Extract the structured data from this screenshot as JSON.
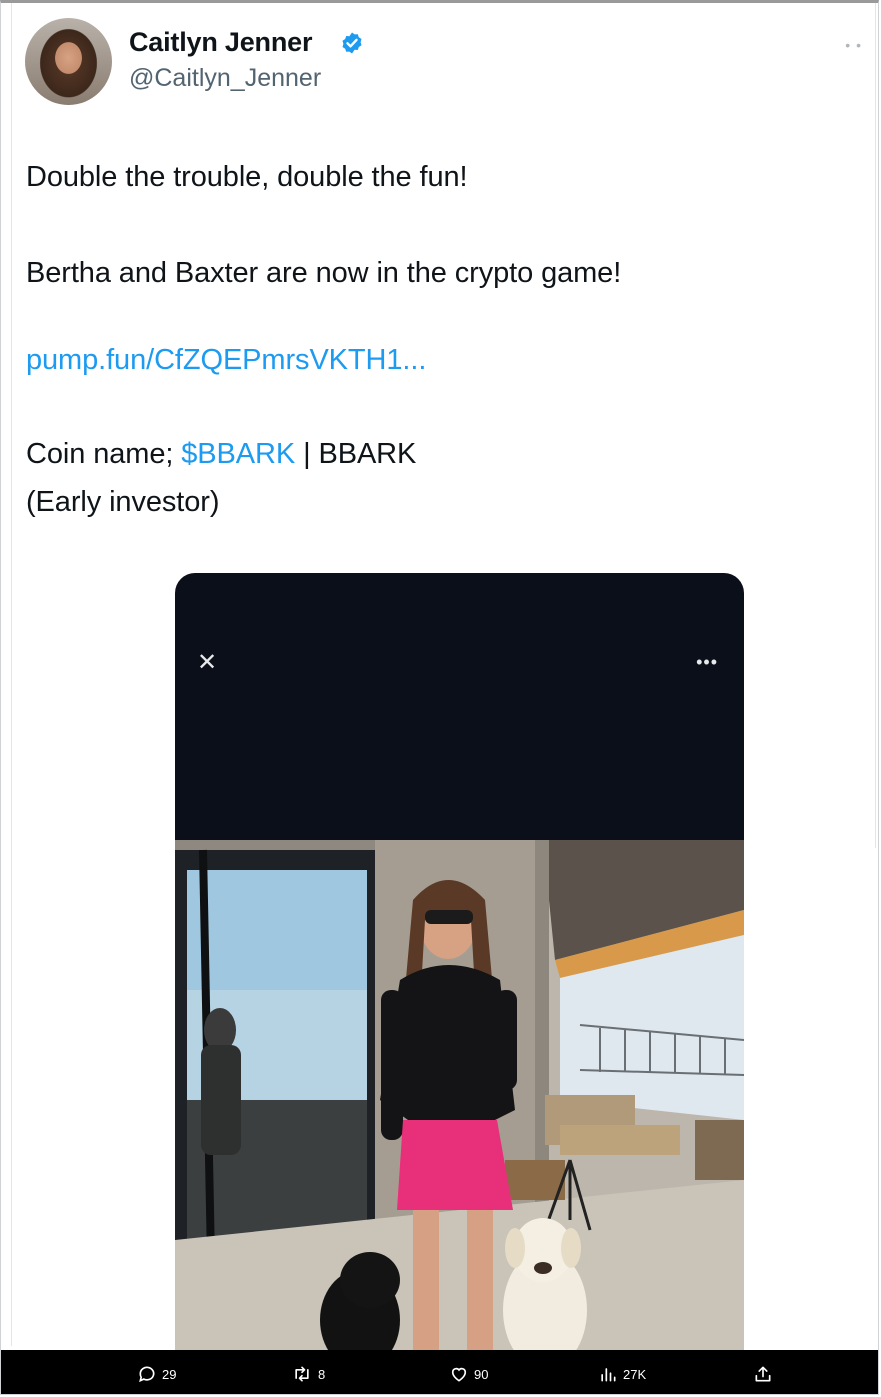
{
  "author": {
    "name": "Caitlyn Jenner",
    "handle": "@Caitlyn_Jenner",
    "verified": true
  },
  "tweet": {
    "line1": "Double the trouble, double the fun!",
    "line2": "Bertha and Baxter are now in the crypto game!",
    "link": "pump.fun/CfZQEPmrsVKTH1...",
    "coin_prefix": "Coin name; ",
    "coin_tag": "$BBARK",
    "coin_suffix": " | BBARK",
    "line_last": "(Early investor)"
  },
  "media": {
    "close_icon": "close-icon",
    "more_icon": "more-icon"
  },
  "actions": {
    "replies": "29",
    "reposts": "8",
    "likes": "90",
    "views": "27K"
  },
  "colors": {
    "link": "#1d9bf0",
    "verified": "#1d9bf0",
    "media_bg": "#0b0f1a",
    "action_bar": "#000000"
  }
}
